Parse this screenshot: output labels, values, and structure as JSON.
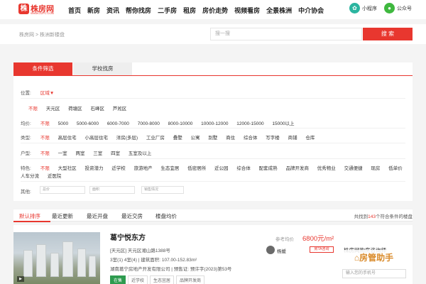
{
  "header": {
    "logo_mark": "株",
    "logo_text": "株房网",
    "logo_sub": "WWW.ZZFC.COM",
    "nav": [
      "首页",
      "新房",
      "资讯",
      "帮你找房",
      "二手房",
      "租房",
      "房价走势",
      "视频看房",
      "全景株洲",
      "中介协会"
    ],
    "mini_program": "小程序",
    "official_account": "公众号"
  },
  "search": {
    "breadcrumb": "株房网 > 株洲新楼盘",
    "placeholder": "搜一搜",
    "button": "搜 索"
  },
  "filter_tabs": [
    "条件筛选",
    "学校找房"
  ],
  "filters": {
    "location": {
      "label": "位置:",
      "value": "区域▼"
    },
    "districts": [
      "不限",
      "天元区",
      "荷塘区",
      "石峰区",
      "芦淞区"
    ],
    "price": {
      "label": "均价:",
      "options": [
        "不限",
        "5000",
        "5000-6000",
        "6000-7000",
        "7000-8000",
        "8000-10000",
        "10000-12000",
        "12000-15000",
        "15000以上"
      ]
    },
    "type": {
      "label": "类型:",
      "options": [
        "不限",
        "高层住宅",
        "小高层住宅",
        "洋房(多层)",
        "工业厂房",
        "叠墅",
        "公寓",
        "别墅",
        "商住",
        "综合体",
        "写字楼",
        "商铺",
        "仓库"
      ]
    },
    "layout": {
      "label": "户型:",
      "options": [
        "不限",
        "一室",
        "两室",
        "三室",
        "四室",
        "五室及以上"
      ]
    },
    "feature": {
      "label": "特色:",
      "options": [
        "不限",
        "大型社区",
        "投资潜力",
        "近学校",
        "旅游地产",
        "生态宜居",
        "低密居所",
        "近公园",
        "综合体",
        "配套成熟",
        "品牌开发商",
        "优秀物业",
        "交通便捷",
        "现房",
        "低单价"
      ],
      "options2": [
        "人车分流",
        "近医院"
      ]
    },
    "other": {
      "label": "其他:",
      "inputs": [
        "总价",
        "面积",
        "销售情况"
      ]
    }
  },
  "sort": {
    "tabs": [
      "默认排序",
      "最近更新",
      "最近开盘",
      "最近交房",
      "楼盘均价"
    ],
    "total_prefix": "共找到",
    "total_count": "143",
    "total_suffix": "个符合条件的楼盘"
  },
  "listing": {
    "title": "葛宁悦东方",
    "address": "[天元区] 天元区湘山路1388号",
    "info": "3室(1) 4室(4)  |  建筑面积: 107.00-152.83m²",
    "developer": "湖南葛宁房地产开发有限公司  |  预售证: 预许字(2023)第53号",
    "tags": [
      "在售",
      "近学校",
      "生态宜居",
      "品牌开发商"
    ],
    "ref_price_label": "参考均价",
    "ref_price": "6800元/m²",
    "agent_name": "杨媛",
    "agent_badge": "房TA咨询",
    "consult_text": "株房网购房咨询师",
    "watermark": "房管助手",
    "phone_placeholder": "输入您的手机号"
  },
  "colors": {
    "accent": "#e8372f"
  }
}
